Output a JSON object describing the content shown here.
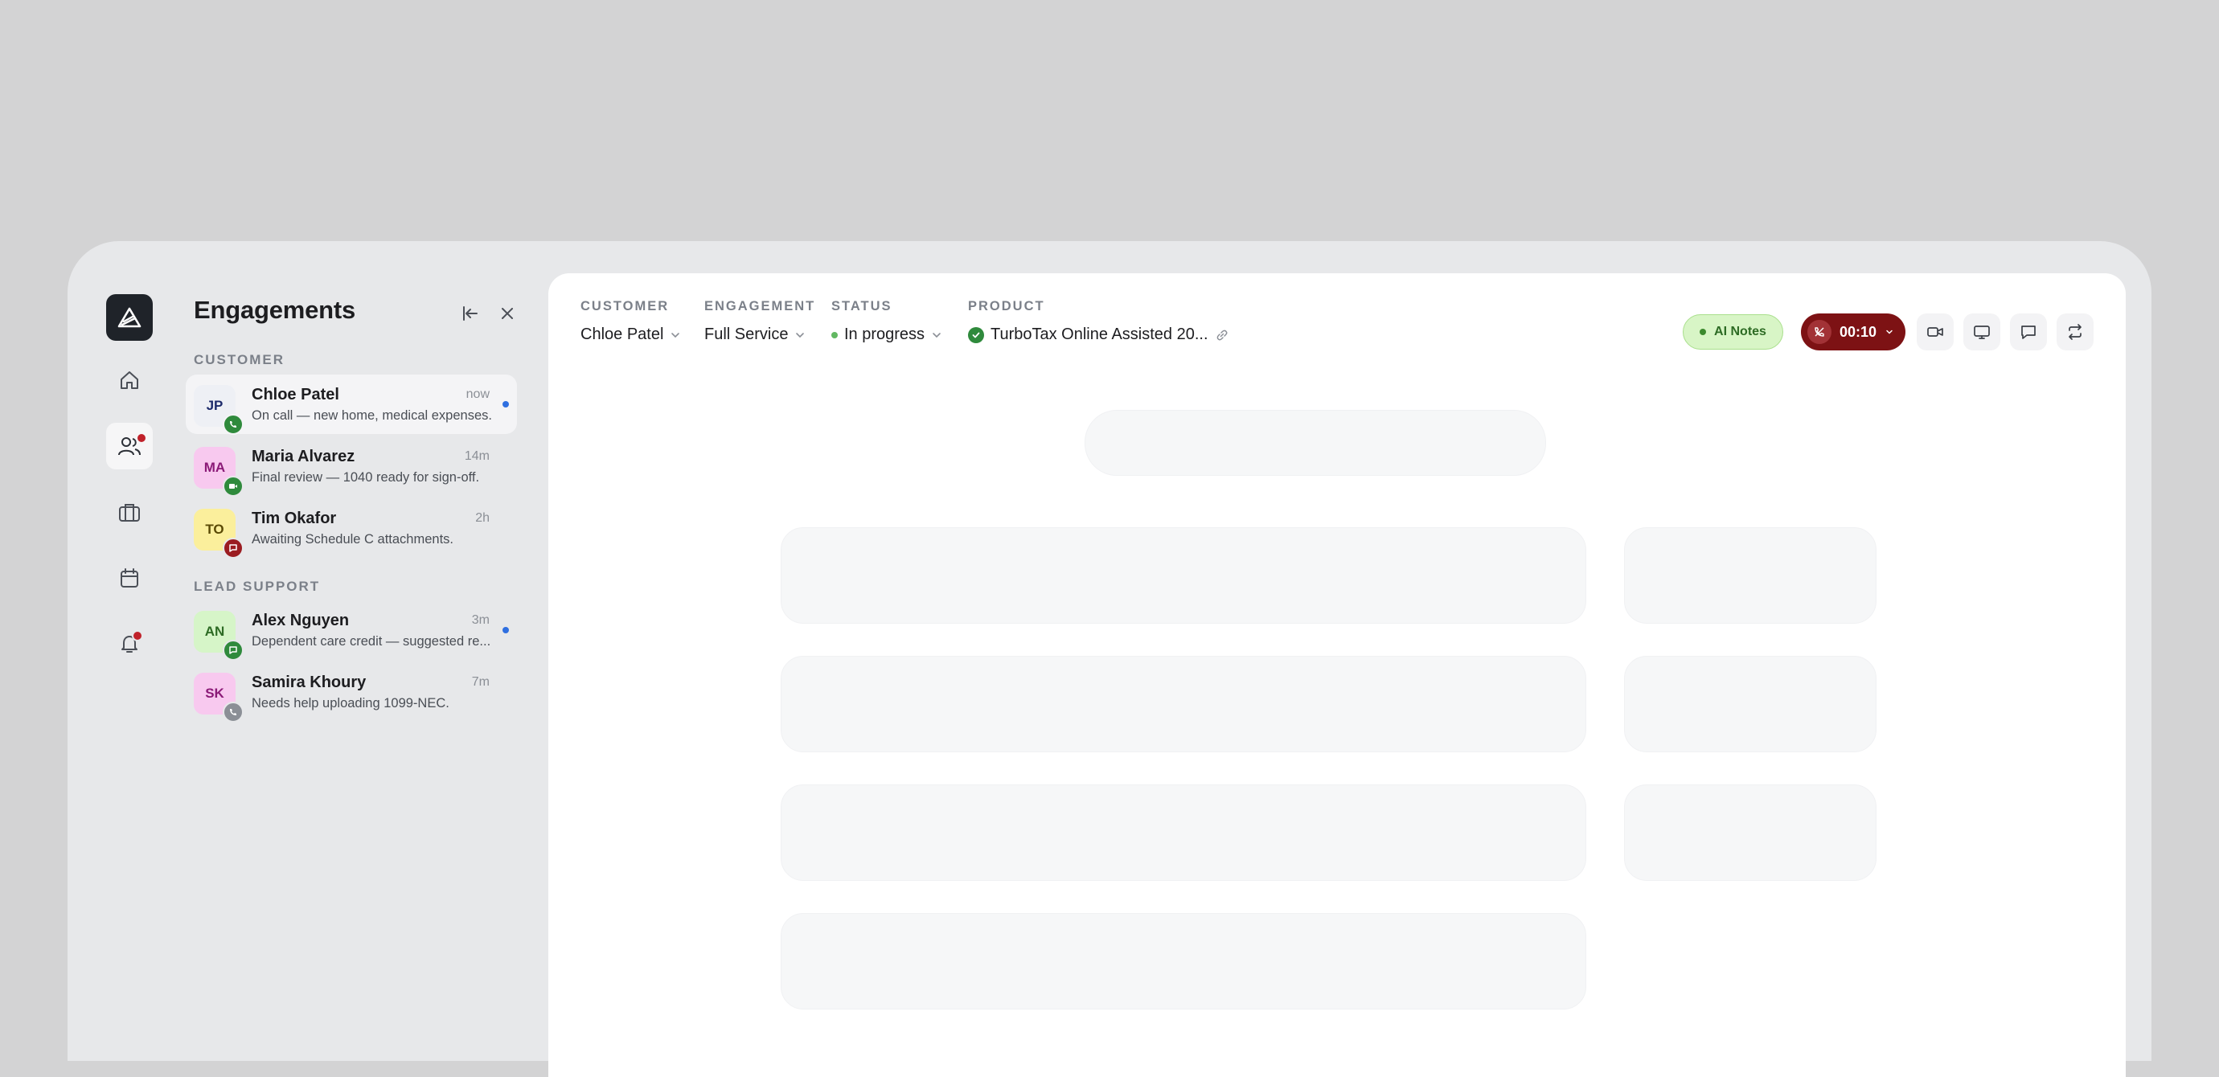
{
  "panel": {
    "title": "Engagements",
    "sections": [
      {
        "label": "CUSTOMER",
        "items": [
          {
            "initials": "JP",
            "name": "Chloe Patel",
            "preview": "On call — new home, medical expenses.",
            "time": "now",
            "unread": true,
            "channel": "phone",
            "avatar_bg": "#eef0f5",
            "avatar_fg": "#1d2b6b",
            "channel_color": "#2f8a3c",
            "active": true
          },
          {
            "initials": "MA",
            "name": "Maria Alvarez",
            "preview": "Final review — 1040 ready for sign-off.",
            "time": "14m",
            "unread": false,
            "channel": "video",
            "avatar_bg": "#f8c9ef",
            "avatar_fg": "#8b1a77",
            "channel_color": "#2f8a3c",
            "active": false
          },
          {
            "initials": "TO",
            "name": "Tim Okafor",
            "preview": "Awaiting Schedule C attachments.",
            "time": "2h",
            "unread": false,
            "channel": "chat",
            "avatar_bg": "#fbef9c",
            "avatar_fg": "#5a4a05",
            "channel_color": "#9b1c21",
            "active": false
          }
        ]
      },
      {
        "label": "LEAD SUPPORT",
        "items": [
          {
            "initials": "AN",
            "name": "Alex Nguyen",
            "preview": "Dependent care credit — suggested re...",
            "time": "3m",
            "unread": true,
            "channel": "chat",
            "avatar_bg": "#d6f5c8",
            "avatar_fg": "#2d6b24",
            "channel_color": "#2f8a3c",
            "active": false
          },
          {
            "initials": "SK",
            "name": "Samira Khoury",
            "preview": "Needs help uploading 1099-NEC.",
            "time": "7m",
            "unread": false,
            "channel": "phone",
            "avatar_bg": "#f8c9ef",
            "avatar_fg": "#8b1a77",
            "channel_color": "#8b8f96",
            "active": false
          }
        ]
      }
    ]
  },
  "header": {
    "customer": {
      "label": "CUSTOMER",
      "value": "Chloe Patel"
    },
    "engagement": {
      "label": "ENGAGEMENT",
      "value": "Full Service"
    },
    "status": {
      "label": "STATUS",
      "value": "In progress"
    },
    "product": {
      "label": "PRODUCT",
      "value": "TurboTax Online Assisted 20..."
    }
  },
  "toolbar": {
    "ai_notes": "AI Notes",
    "call_timer": "00:10"
  },
  "colors": {
    "accent_call": "#7d1214",
    "ai_notes_bg": "#d8f5c6",
    "unread": "#2f6fe0"
  }
}
